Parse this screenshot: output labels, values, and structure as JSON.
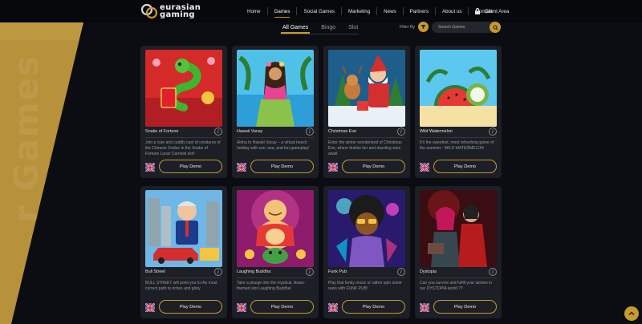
{
  "brand": {
    "line1": "eurasian",
    "line2": "gaming",
    "accent_color": "#c79a2e"
  },
  "nav": {
    "items": [
      {
        "label": "Home",
        "active": false
      },
      {
        "label": "Games",
        "active": true
      },
      {
        "label": "Social Games",
        "active": false
      },
      {
        "label": "Marketing",
        "active": false
      },
      {
        "label": "News",
        "active": false
      },
      {
        "label": "Partners",
        "active": false
      },
      {
        "label": "About us",
        "active": false
      },
      {
        "label": "Contact",
        "active": false
      }
    ],
    "client_area": "Client Area"
  },
  "side_banner_text": "r Games",
  "tabs": [
    {
      "label": "All Games",
      "active": true
    },
    {
      "label": "Bingo",
      "active": false
    },
    {
      "label": "Slot",
      "active": false
    }
  ],
  "filter_label": "Filter By",
  "search": {
    "placeholder": "Search Games"
  },
  "play_label": "Play Demo",
  "games": [
    {
      "title": "Snake of Fortune",
      "desc": "Join a cute and cuddly cast of creatures of the Chinese Zodiac in the Snake of Fortune Lunar Carnival slot!",
      "icon": "snake-art"
    },
    {
      "title": "Hawaii Vacay",
      "desc": "Aloha to Hawaii Vacay – a virtual beach holiday with sun, sea, and fun gameplay!",
      "icon": "hula-art"
    },
    {
      "title": "Christmas Eve",
      "desc": "Enter the winter wonderland of Christmas Eve, where festive fun and dazzling wins await",
      "icon": "santa-art"
    },
    {
      "title": "Wild Watermelon",
      "desc": "It's the sweetest, most refreshing game of the summer : WILD WATERMELON",
      "icon": "fruit-art"
    },
    {
      "title": "Bull Street",
      "desc": "BULL STREET will point you to the most correct path to riches and glory",
      "icon": "tycoon-art"
    },
    {
      "title": "Laughing Buddha",
      "desc": "Take a plunge into the mystical, Asian-themed slot Laughing Buddha!",
      "icon": "buddha-art"
    },
    {
      "title": "Funk Pub",
      "desc": "Play that funky music or rather spin some reels with FUNK PUB!",
      "icon": "funk-art"
    },
    {
      "title": "Dystopia",
      "desc": "Can you survive and fulfill your wishes in our DYSTOPIA world ??",
      "icon": "dystopia-art"
    }
  ]
}
